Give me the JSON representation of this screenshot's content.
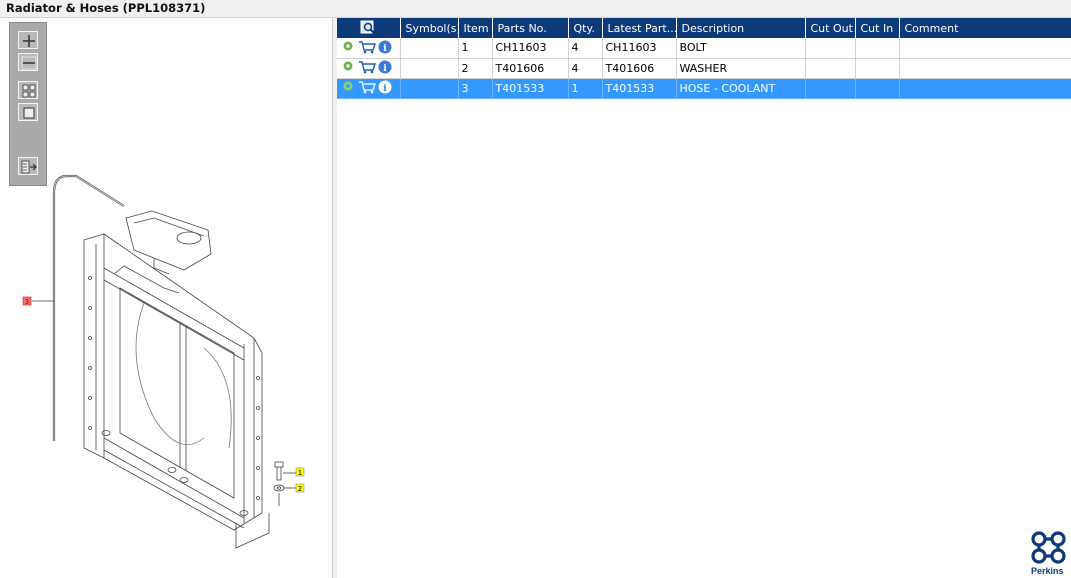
{
  "window": {
    "title": "Radiator & Hoses (PPL108371)"
  },
  "toolbar": {
    "buttons": [
      "zoom-in-icon",
      "zoom-out-icon",
      "fit-view-icon",
      "actual-size-icon",
      "export-icon"
    ]
  },
  "drawing": {
    "callouts": [
      {
        "label": "1"
      },
      {
        "label": "2"
      },
      {
        "label": "3"
      }
    ]
  },
  "table": {
    "columns": [
      "",
      "Symbol(s)",
      "Item",
      "Parts No.",
      "Qty.",
      "Latest Part...",
      "Description",
      "Cut Out",
      "Cut In",
      "Comment"
    ],
    "rows": [
      {
        "item": "1",
        "part_no": "CH11603",
        "qty": "4",
        "latest_part": "CH11603",
        "description": "BOLT",
        "symbols": "",
        "cut_out": "",
        "cut_in": "",
        "comment": "",
        "selected": false
      },
      {
        "item": "2",
        "part_no": "T401606",
        "qty": "4",
        "latest_part": "T401606",
        "description": "WASHER",
        "symbols": "",
        "cut_out": "",
        "cut_in": "",
        "comment": "",
        "selected": false
      },
      {
        "item": "3",
        "part_no": "T401533",
        "qty": "1",
        "latest_part": "T401533",
        "description": "HOSE - COOLANT",
        "symbols": "",
        "cut_out": "",
        "cut_in": "",
        "comment": "",
        "selected": true
      }
    ]
  },
  "brand": {
    "name": "Perkins",
    "color": "#0d3a79"
  },
  "colors": {
    "header_bg": "#0d3a79",
    "selected_row": "#3399ff",
    "callout_highlight": "#ffff00",
    "callout_selected": "#ff6f6f"
  }
}
